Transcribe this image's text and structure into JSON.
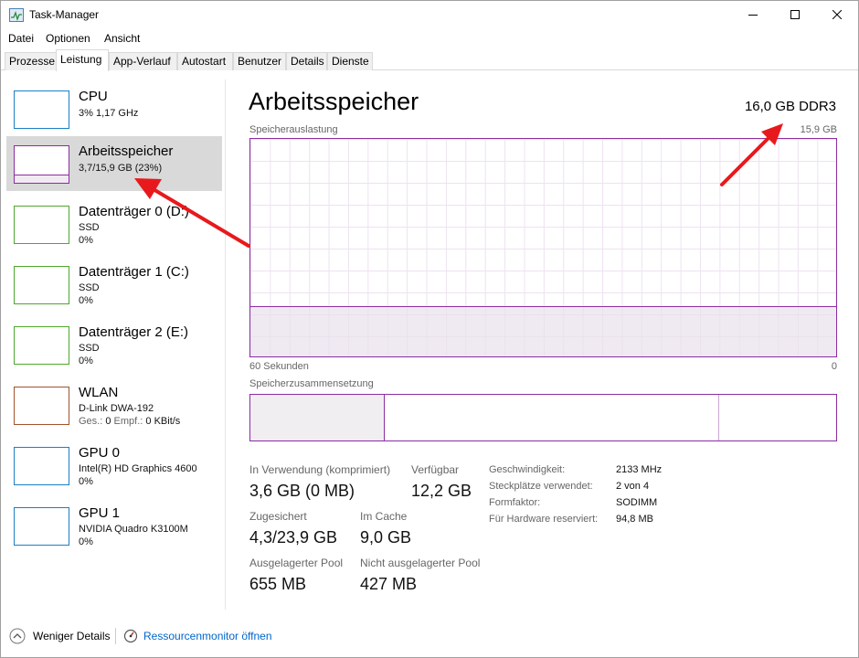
{
  "window": {
    "title": "Task-Manager"
  },
  "menu": [
    "Datei",
    "Optionen",
    "Ansicht"
  ],
  "tabs": [
    "Prozesse",
    "Leistung",
    "App-Verlauf",
    "Autostart",
    "Benutzer",
    "Details",
    "Dienste"
  ],
  "active_tab": "Leistung",
  "sidebar": {
    "items": [
      {
        "title": "CPU",
        "lines": [
          "3% 1,17 GHz"
        ],
        "color": "#1b7fc3"
      },
      {
        "title": "Arbeitsspeicher",
        "lines": [
          "3,7/15,9 GB (23%)"
        ],
        "color": "#8b2da0",
        "selected": true
      },
      {
        "title": "Datenträger 0 (D:)",
        "lines": [
          "SSD",
          "0%"
        ],
        "color": "#4ea72e"
      },
      {
        "title": "Datenträger 1 (C:)",
        "lines": [
          "SSD",
          "0%"
        ],
        "color": "#4ea72e"
      },
      {
        "title": "Datenträger 2 (E:)",
        "lines": [
          "SSD",
          "0%"
        ],
        "color": "#4ea72e"
      },
      {
        "title": "WLAN",
        "lines": [
          "D-Link DWA-192"
        ],
        "net": {
          "send_label": "Ges.:",
          "send": "0",
          "recv_label": "Empf.:",
          "recv": "0 KBit/s"
        },
        "color": "#a0522d"
      },
      {
        "title": "GPU 0",
        "lines": [
          "Intel(R) HD Graphics 4600",
          "0%"
        ],
        "color": "#1b7fc3"
      },
      {
        "title": "GPU 1",
        "lines": [
          "NVIDIA Quadro K3100M",
          "0%"
        ],
        "color": "#1b7fc3"
      }
    ]
  },
  "main": {
    "title": "Arbeitsspeicher",
    "spec": "16,0 GB DDR3",
    "usage_label": "Speicherauslastung",
    "usage_max": "15,9 GB",
    "usage_fraction": 0.23,
    "time_left": "60 Sekunden",
    "time_right": "0",
    "composition_label": "Speicherzusammensetzung",
    "composition": {
      "in_use": 0.23,
      "modified": 0.0,
      "standby": 0.57,
      "free": 0.2
    },
    "accent_color": "#8b2da0",
    "stats": {
      "in_use_label": "In Verwendung (komprimiert)",
      "in_use_value": "3,6 GB (0 MB)",
      "available_label": "Verfügbar",
      "available_value": "12,2 GB",
      "committed_label": "Zugesichert",
      "committed_value": "4,3/23,9 GB",
      "cached_label": "Im Cache",
      "cached_value": "9,0 GB",
      "paged_label": "Ausgelagerter Pool",
      "paged_value": "655 MB",
      "nonpaged_label": "Nicht ausgelagerter Pool",
      "nonpaged_value": "427 MB"
    },
    "specs": [
      {
        "label": "Geschwindigkeit:",
        "value": "2133 MHz"
      },
      {
        "label": "Steckplätze verwendet:",
        "value": "2 von 4"
      },
      {
        "label": "Formfaktor:",
        "value": "SODIMM"
      },
      {
        "label": "Für Hardware reserviert:",
        "value": "94,8 MB"
      }
    ]
  },
  "footer": {
    "fewer_details": "Weniger Details",
    "resource_monitor": "Ressourcenmonitor öffnen"
  },
  "annotation_color": "#e8191c"
}
